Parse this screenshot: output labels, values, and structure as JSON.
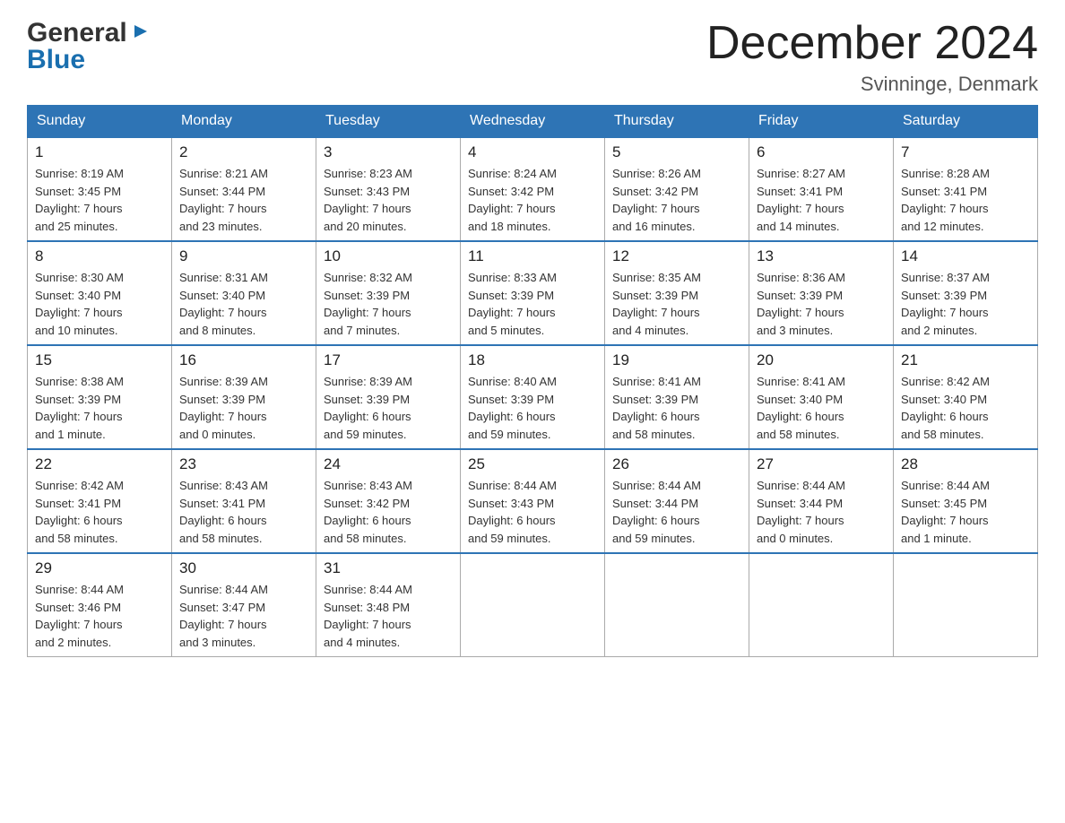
{
  "logo": {
    "general": "General",
    "blue": "Blue",
    "arrow": "▶"
  },
  "title": "December 2024",
  "subtitle": "Svinninge, Denmark",
  "weekdays": [
    "Sunday",
    "Monday",
    "Tuesday",
    "Wednesday",
    "Thursday",
    "Friday",
    "Saturday"
  ],
  "weeks": [
    [
      {
        "day": "1",
        "sunrise": "8:19 AM",
        "sunset": "3:45 PM",
        "daylight": "7 hours and 25 minutes."
      },
      {
        "day": "2",
        "sunrise": "8:21 AM",
        "sunset": "3:44 PM",
        "daylight": "7 hours and 23 minutes."
      },
      {
        "day": "3",
        "sunrise": "8:23 AM",
        "sunset": "3:43 PM",
        "daylight": "7 hours and 20 minutes."
      },
      {
        "day": "4",
        "sunrise": "8:24 AM",
        "sunset": "3:42 PM",
        "daylight": "7 hours and 18 minutes."
      },
      {
        "day": "5",
        "sunrise": "8:26 AM",
        "sunset": "3:42 PM",
        "daylight": "7 hours and 16 minutes."
      },
      {
        "day": "6",
        "sunrise": "8:27 AM",
        "sunset": "3:41 PM",
        "daylight": "7 hours and 14 minutes."
      },
      {
        "day": "7",
        "sunrise": "8:28 AM",
        "sunset": "3:41 PM",
        "daylight": "7 hours and 12 minutes."
      }
    ],
    [
      {
        "day": "8",
        "sunrise": "8:30 AM",
        "sunset": "3:40 PM",
        "daylight": "7 hours and 10 minutes."
      },
      {
        "day": "9",
        "sunrise": "8:31 AM",
        "sunset": "3:40 PM",
        "daylight": "7 hours and 8 minutes."
      },
      {
        "day": "10",
        "sunrise": "8:32 AM",
        "sunset": "3:39 PM",
        "daylight": "7 hours and 7 minutes."
      },
      {
        "day": "11",
        "sunrise": "8:33 AM",
        "sunset": "3:39 PM",
        "daylight": "7 hours and 5 minutes."
      },
      {
        "day": "12",
        "sunrise": "8:35 AM",
        "sunset": "3:39 PM",
        "daylight": "7 hours and 4 minutes."
      },
      {
        "day": "13",
        "sunrise": "8:36 AM",
        "sunset": "3:39 PM",
        "daylight": "7 hours and 3 minutes."
      },
      {
        "day": "14",
        "sunrise": "8:37 AM",
        "sunset": "3:39 PM",
        "daylight": "7 hours and 2 minutes."
      }
    ],
    [
      {
        "day": "15",
        "sunrise": "8:38 AM",
        "sunset": "3:39 PM",
        "daylight": "7 hours and 1 minute."
      },
      {
        "day": "16",
        "sunrise": "8:39 AM",
        "sunset": "3:39 PM",
        "daylight": "7 hours and 0 minutes."
      },
      {
        "day": "17",
        "sunrise": "8:39 AM",
        "sunset": "3:39 PM",
        "daylight": "6 hours and 59 minutes."
      },
      {
        "day": "18",
        "sunrise": "8:40 AM",
        "sunset": "3:39 PM",
        "daylight": "6 hours and 59 minutes."
      },
      {
        "day": "19",
        "sunrise": "8:41 AM",
        "sunset": "3:39 PM",
        "daylight": "6 hours and 58 minutes."
      },
      {
        "day": "20",
        "sunrise": "8:41 AM",
        "sunset": "3:40 PM",
        "daylight": "6 hours and 58 minutes."
      },
      {
        "day": "21",
        "sunrise": "8:42 AM",
        "sunset": "3:40 PM",
        "daylight": "6 hours and 58 minutes."
      }
    ],
    [
      {
        "day": "22",
        "sunrise": "8:42 AM",
        "sunset": "3:41 PM",
        "daylight": "6 hours and 58 minutes."
      },
      {
        "day": "23",
        "sunrise": "8:43 AM",
        "sunset": "3:41 PM",
        "daylight": "6 hours and 58 minutes."
      },
      {
        "day": "24",
        "sunrise": "8:43 AM",
        "sunset": "3:42 PM",
        "daylight": "6 hours and 58 minutes."
      },
      {
        "day": "25",
        "sunrise": "8:44 AM",
        "sunset": "3:43 PM",
        "daylight": "6 hours and 59 minutes."
      },
      {
        "day": "26",
        "sunrise": "8:44 AM",
        "sunset": "3:44 PM",
        "daylight": "6 hours and 59 minutes."
      },
      {
        "day": "27",
        "sunrise": "8:44 AM",
        "sunset": "3:44 PM",
        "daylight": "7 hours and 0 minutes."
      },
      {
        "day": "28",
        "sunrise": "8:44 AM",
        "sunset": "3:45 PM",
        "daylight": "7 hours and 1 minute."
      }
    ],
    [
      {
        "day": "29",
        "sunrise": "8:44 AM",
        "sunset": "3:46 PM",
        "daylight": "7 hours and 2 minutes."
      },
      {
        "day": "30",
        "sunrise": "8:44 AM",
        "sunset": "3:47 PM",
        "daylight": "7 hours and 3 minutes."
      },
      {
        "day": "31",
        "sunrise": "8:44 AM",
        "sunset": "3:48 PM",
        "daylight": "7 hours and 4 minutes."
      },
      null,
      null,
      null,
      null
    ]
  ],
  "labels": {
    "sunrise": "Sunrise:",
    "sunset": "Sunset:",
    "daylight": "Daylight:"
  }
}
